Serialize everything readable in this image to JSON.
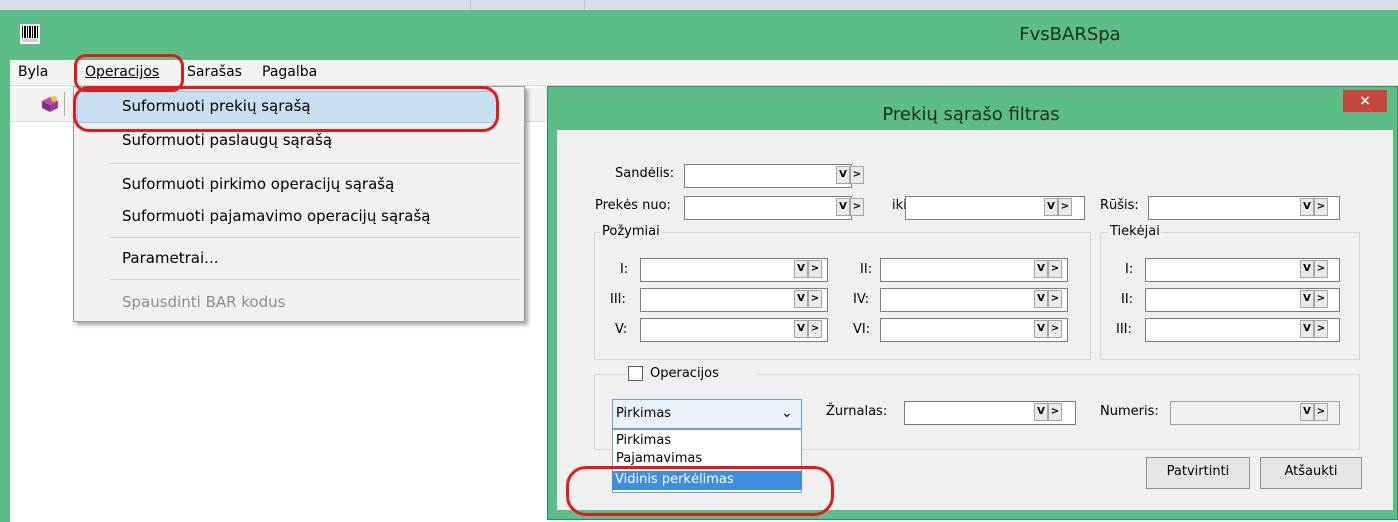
{
  "window": {
    "title": "FvsBARSpa"
  },
  "menubar": [
    "Byla",
    "Operacijos",
    "Sarašas",
    "Pagalba"
  ],
  "operations_menu": {
    "items": [
      "Suformuoti prekių sąrašą",
      "Suformuoti paslaugų sąrašą",
      "Suformuoti pirkimo operacijų sąrašą",
      "Suformuoti pajamavimo operacijų sąrašą",
      "Parametrai...",
      "Spausdinti BAR kodus"
    ]
  },
  "dialog": {
    "title": "Prekių sąrašo filtras",
    "close_label": "×",
    "sandelis_label": "Sandėlis:",
    "prekes_nuo_label": "Prekės nuo:",
    "iki_label": "iki",
    "rusis_label": "Rūšis:",
    "pozymiai_title": "Požymiai",
    "tiekejai_title": "Tiekėjai",
    "pozymiai_labels": [
      "I:",
      "II:",
      "III:",
      "IV:",
      "V:",
      "VI:"
    ],
    "tiekejai_labels": [
      "I:",
      "II:",
      "III:"
    ],
    "operacijos_label": "Operacijos",
    "operacijos_checked": false,
    "operation_type": {
      "selected": "Pirkimas",
      "options": [
        "Pirkimas",
        "Pajamavimas",
        "Vidinis perkėlimas"
      ],
      "highlighted": "Vidinis perkėlimas"
    },
    "zurnalas_label": "Žurnalas:",
    "numeris_label": "Numeris:",
    "confirm_label": "Patvirtinti",
    "cancel_label": "Atšaukti",
    "lookup_button_glyph": "V",
    "next_button_glyph": ">",
    "combo_arrow_glyph": "⌄"
  },
  "colors": {
    "accent_green": "#5dbd86",
    "highlight_blue": "#3e8ee2",
    "annotation_red": "#e01b1b",
    "close_red": "#c7453d"
  }
}
